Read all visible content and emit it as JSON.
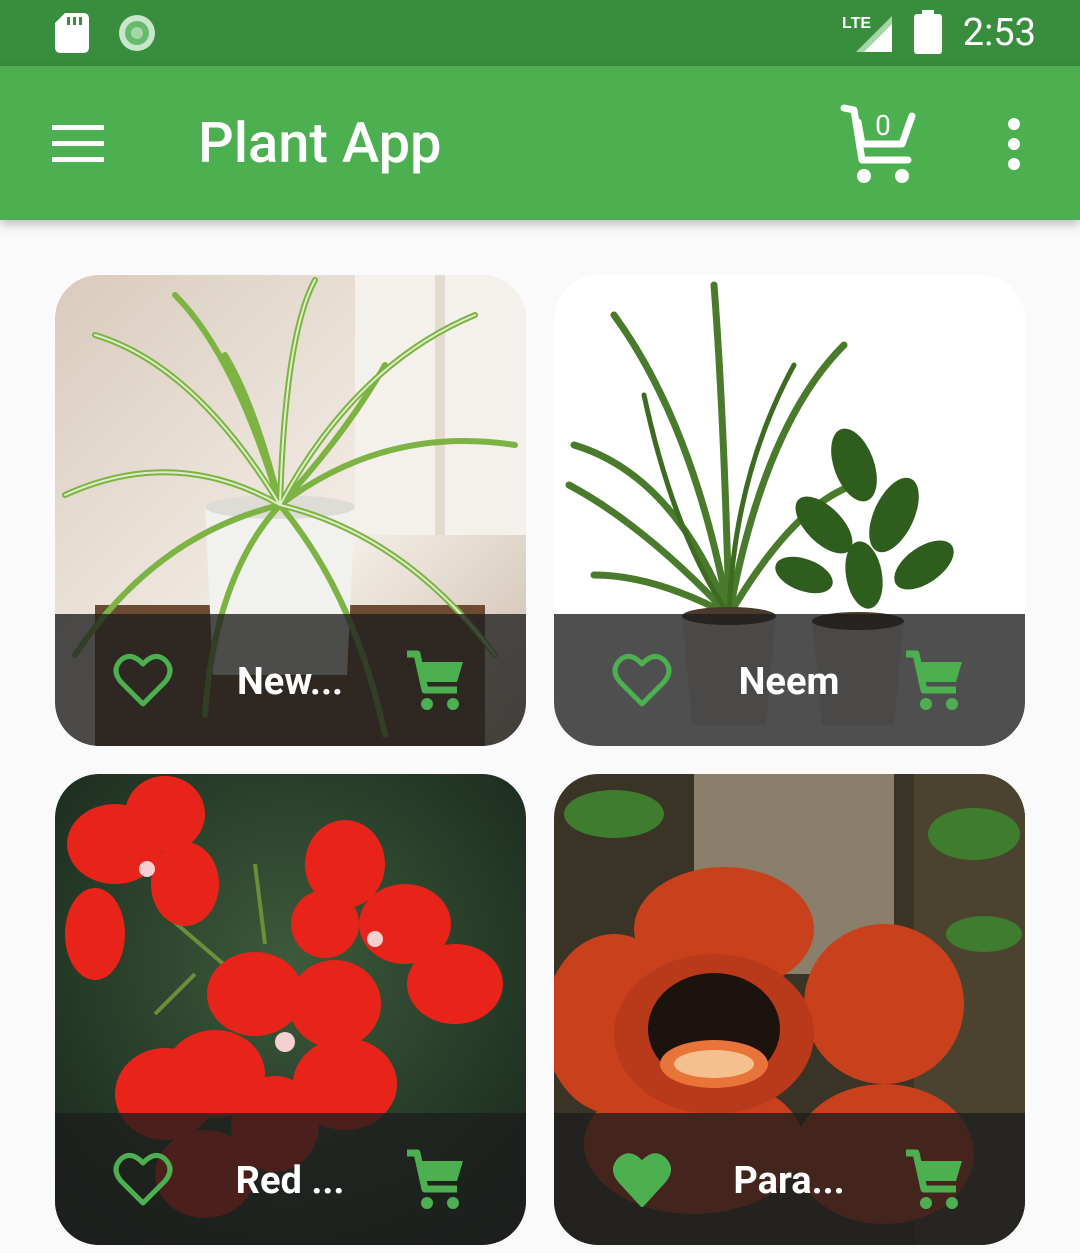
{
  "status_bar": {
    "time": "2:53",
    "network": "LTE",
    "icons": [
      "sd-card-icon",
      "sync-icon",
      "lte-signal-icon",
      "battery-icon"
    ]
  },
  "app_bar": {
    "title": "Plant App",
    "cart_count": "0",
    "icons": [
      "menu-icon",
      "cart-icon",
      "more-vert-icon"
    ]
  },
  "colors": {
    "status_bar": "#388e3c",
    "app_bar": "#4caf50",
    "accent": "#4caf50",
    "background": "#fafafa"
  },
  "plants": [
    {
      "name": "New...",
      "favorite": false
    },
    {
      "name": "Neem",
      "favorite": false
    },
    {
      "name": "Red ...",
      "favorite": false
    },
    {
      "name": "Para...",
      "favorite": true
    }
  ]
}
